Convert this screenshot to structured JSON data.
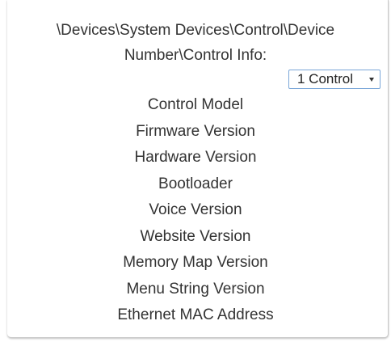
{
  "path": {
    "line1": "\\Devices\\System Devices\\Control\\Device",
    "line2": "Number\\Control Info:"
  },
  "control_select": {
    "selected": "1 Control",
    "arrow_icon": "dropdown-arrow-icon"
  },
  "info_items": [
    "Control Model",
    "Firmware Version",
    "Hardware Version",
    "Bootloader",
    "Voice Version",
    "Website Version",
    "Memory Map Version",
    "Menu String Version",
    "Ethernet MAC Address"
  ],
  "colors": {
    "text": "#333333",
    "select_border": "#7aa7d8",
    "panel_border": "#c9c9c9"
  }
}
